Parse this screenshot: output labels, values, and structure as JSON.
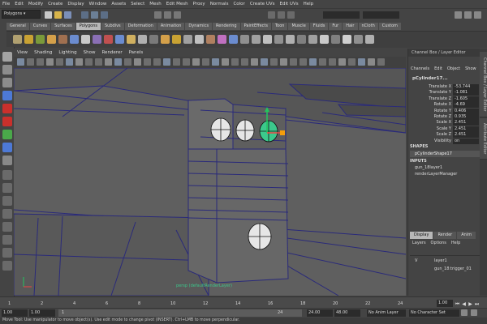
{
  "menu": [
    "File",
    "Edit",
    "Modify",
    "Create",
    "Display",
    "Window",
    "Assets",
    "Select",
    "Mesh",
    "Edit Mesh",
    "Proxy",
    "Normals",
    "Color",
    "Create UVs",
    "Edit UVs",
    "Help"
  ],
  "status_line": {
    "mode": "Polygons"
  },
  "shelf_tabs": [
    "General",
    "Curves",
    "Surfaces",
    "Polygons",
    "Subdivs",
    "Deformation",
    "Animation",
    "Dynamics",
    "Rendering",
    "PaintEffects",
    "Toon",
    "Muscle",
    "Fluids",
    "Fur",
    "Hair",
    "nCloth",
    "Custom"
  ],
  "active_shelf_tab": "Polygons",
  "panel_menu": [
    "View",
    "Shading",
    "Lighting",
    "Show",
    "Renderer",
    "Panels"
  ],
  "viewport": {
    "camera_label": "persp (defaultRenderLayer)"
  },
  "channel_box": {
    "title": "Channel Box / Layer Editor",
    "menu": [
      "Channels",
      "Edit",
      "Object",
      "Show"
    ],
    "object_name": "pCylinder17...",
    "attributes": [
      {
        "name": "Translate X",
        "value": "-53.744"
      },
      {
        "name": "Translate Y",
        "value": "-1.081"
      },
      {
        "name": "Translate Z",
        "value": "-1.605"
      },
      {
        "name": "Rotate X",
        "value": "-4.69"
      },
      {
        "name": "Rotate Y",
        "value": "0.406"
      },
      {
        "name": "Rotate Z",
        "value": "0.935"
      },
      {
        "name": "Scale X",
        "value": "2.451"
      },
      {
        "name": "Scale Y",
        "value": "2.451"
      },
      {
        "name": "Scale Z",
        "value": "2.451"
      },
      {
        "name": "Visibility",
        "value": "on"
      }
    ],
    "shapes_header": "SHAPES",
    "shape_item": "pCylinderShape17",
    "inputs_header": "INPUTS",
    "inputs": [
      "gun_18layer1",
      "renderLayerManager"
    ]
  },
  "side_tabs": [
    "Channel Box / Layer Editor",
    "Attribute Editor"
  ],
  "layer_editor": {
    "tabs": [
      "Display",
      "Render",
      "Anim"
    ],
    "active_tab": "Display",
    "menu": [
      "Layers",
      "Options",
      "Help"
    ],
    "layers": [
      {
        "visible": "V",
        "name": "layer1"
      },
      {
        "visible": "",
        "name": "gun_18:trigger_01"
      }
    ]
  },
  "timeline": {
    "ticks": [
      "1",
      "2",
      "4",
      "6",
      "8",
      "10",
      "12",
      "14",
      "16",
      "18",
      "20",
      "22",
      "24"
    ],
    "current_frame": "1.00"
  },
  "range": {
    "start": "1.00",
    "anim_start": "1.00",
    "range_start": "1",
    "range_end": "24",
    "anim_end": "24.00",
    "end": "48.00",
    "anim_layer": "No Anim Layer",
    "character_set": "No Character Set"
  },
  "help_line": "Move Tool: Use manipulator to move object(s). Use edit mode to change pivot (INSERT). Ctrl+LMB to move perpendicular.",
  "colors": {
    "viewport_bg": "#5f5f5f",
    "wire": "#2a2a7a",
    "selected": "#3cc88c",
    "manip_y": "#22c55e",
    "manip_x": "#ef4444"
  }
}
